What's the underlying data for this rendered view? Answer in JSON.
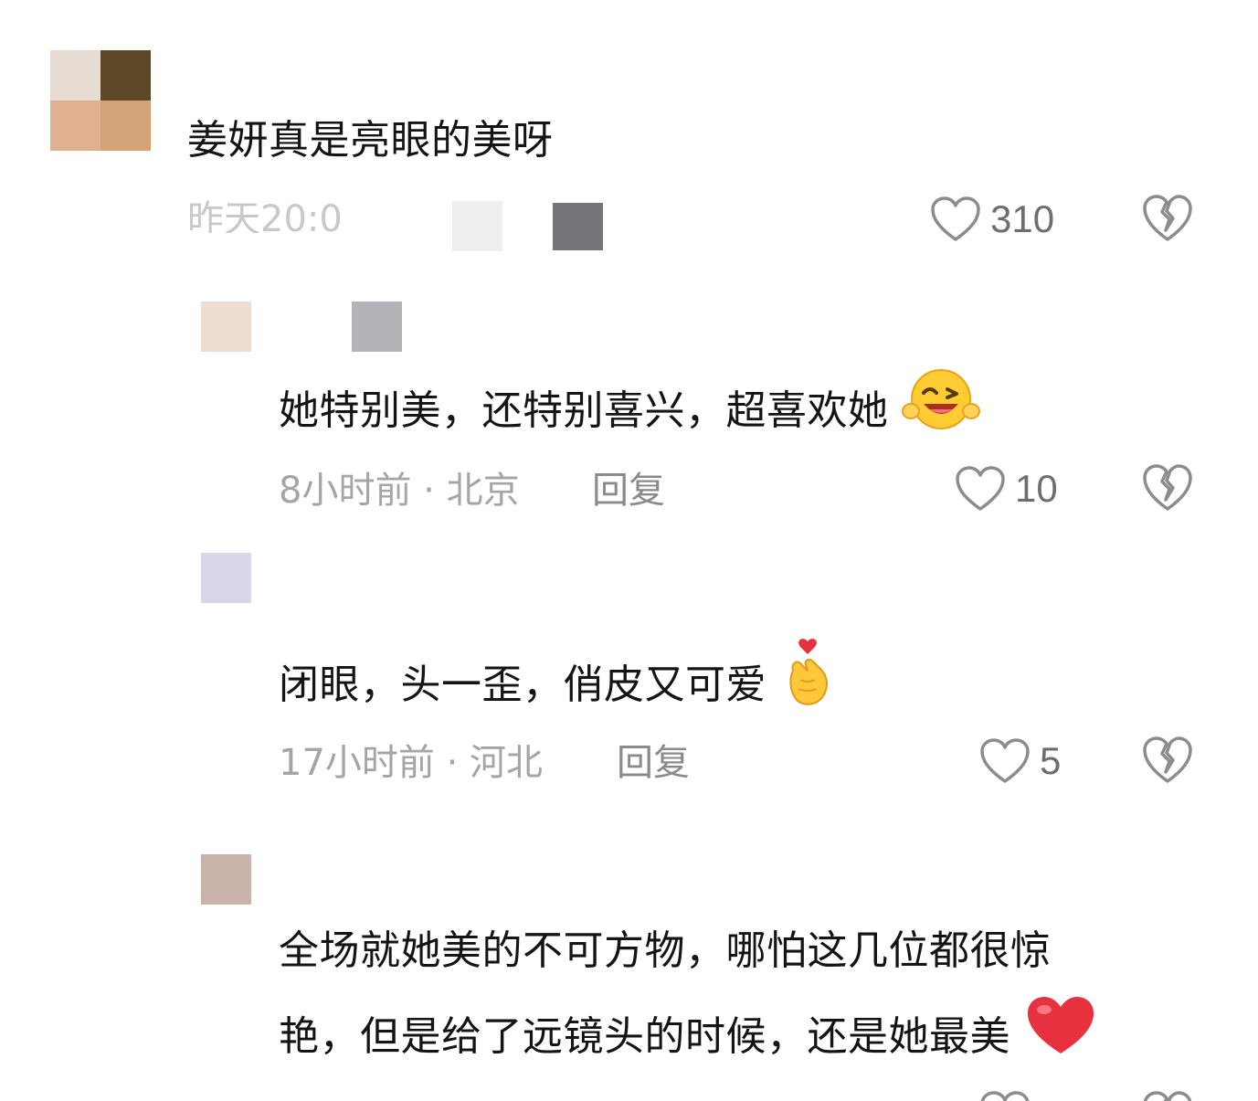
{
  "comments": [
    {
      "text": "姜妍真是亮眼的美呀",
      "meta": "昨天20:0",
      "likes": "310"
    },
    {
      "text": "她特别美，还特别喜兴，超喜欢她",
      "meta": "8小时前 · 北京",
      "reply_label": "回复",
      "likes": "10",
      "emoji": "laughing-wink-emoji"
    },
    {
      "text": "闭眼，头一歪，俏皮又可爱",
      "meta": "17小时前 · 河北",
      "reply_label": "回复",
      "likes": "5",
      "emoji": "finger-heart-emoji"
    },
    {
      "text_line1": "全场就她美的不可方物，哪怕这几位都很惊",
      "text_line2": "艳，但是给了远镜头的时候，还是她最美",
      "emoji": "red-heart-emoji"
    }
  ],
  "colors": {
    "icon_gray": "#8c8c8c",
    "meta_gray": "#a5a5a5",
    "count_gray": "#6e6e6e",
    "heart_red": "#e8313f"
  },
  "icons": [
    "heart-outline-icon",
    "broken-heart-icon"
  ]
}
